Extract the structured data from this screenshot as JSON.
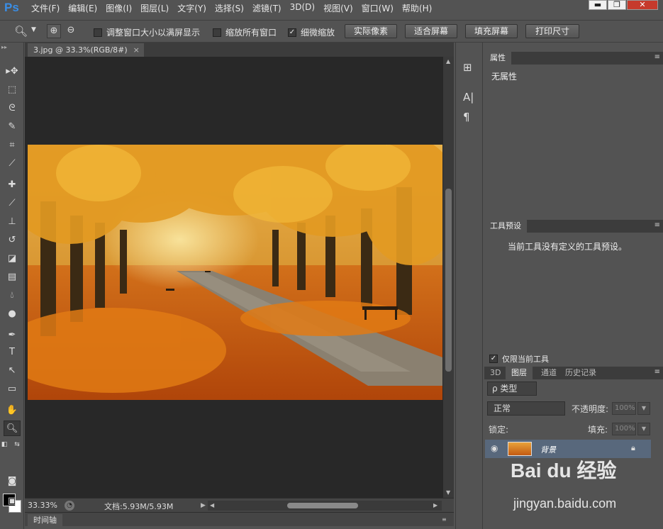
{
  "app": {
    "logo": "Ps"
  },
  "menu": [
    "文件(F)",
    "编辑(E)",
    "图像(I)",
    "图层(L)",
    "文字(Y)",
    "选择(S)",
    "滤镜(T)",
    "3D(D)",
    "视图(V)",
    "窗口(W)",
    "帮助(H)"
  ],
  "window_controls": {
    "minimize": "▬",
    "maximize": "❐",
    "close": "✕"
  },
  "options": {
    "resize_windows": "调整窗口大小以满屏显示",
    "zoom_all": "缩放所有窗口",
    "scrubby_zoom": "细微缩放",
    "scrubby_checked": "✓",
    "actual_pixels": "实际像素",
    "fit_screen": "适合屏幕",
    "fill_screen": "填充屏幕",
    "print_size": "打印尺寸"
  },
  "document": {
    "tab_title": "3.jpg @ 33.3%(RGB/8#)",
    "tab_close": "×"
  },
  "status": {
    "zoom": "33.33%",
    "doc_info": "文档:5.93M/5.93M"
  },
  "timeline": {
    "label": "时间轴"
  },
  "properties": {
    "tab": "属性",
    "text": "无属性"
  },
  "tool_presets": {
    "tab": "工具预设",
    "text": "当前工具没有定义的工具预设。",
    "only_current": "仅限当前工具"
  },
  "layers": {
    "tabs": [
      "3D",
      "图层",
      "通道",
      "历史记录"
    ],
    "active_tab": "图层",
    "filter_kind": "ρ 类型",
    "blend_mode": "正常",
    "opacity_label": "不透明度:",
    "opacity_value": "100%",
    "lock_label": "锁定:",
    "fill_label": "填充:",
    "fill_value": "100%",
    "layer_name": "背景"
  },
  "watermark": {
    "brand": "Bai du 经验",
    "url": "jingyan.baidu.com"
  },
  "colors": {
    "accent": "#3a8ee6",
    "ui_bg": "#535353",
    "canvas_bg": "#282828",
    "selected_layer": "#58687c"
  }
}
